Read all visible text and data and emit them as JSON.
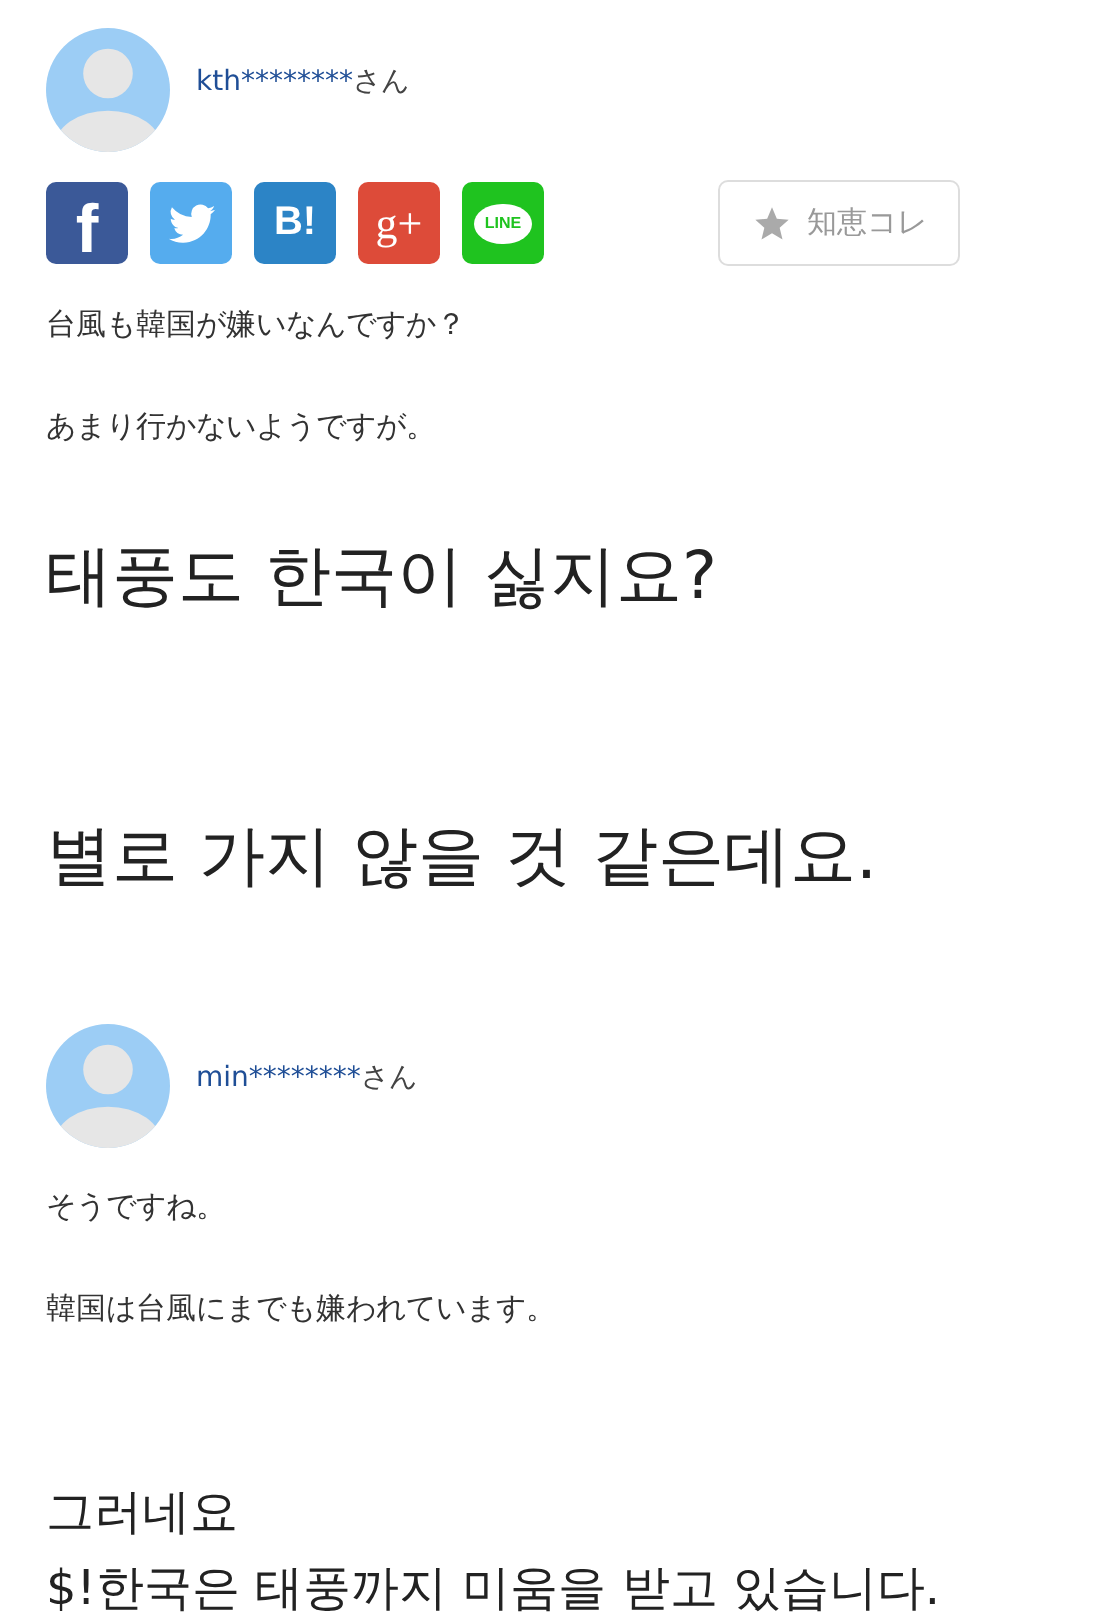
{
  "question": {
    "user": {
      "name": "kth********",
      "suffix": "さん"
    },
    "share_buttons": [
      {
        "kind": "facebook",
        "label": "f"
      },
      {
        "kind": "twitter"
      },
      {
        "kind": "hatena",
        "label": "B!"
      },
      {
        "kind": "google",
        "label": "g+"
      },
      {
        "kind": "line",
        "label": "LINE"
      }
    ],
    "collect_button": {
      "label": "知恵コレ"
    },
    "body": [
      "台風も韓国が嫌いなんですか？",
      "あまり行かないようですが。"
    ]
  },
  "translation_1": [
    "태풍도 한국이 싫지요?",
    "별로 가지 않을 것 같은데요."
  ],
  "answer": {
    "user": {
      "name": "min********",
      "suffix": "さん"
    },
    "body": [
      "そうですね。",
      "韓国は台風にまでも嫌われています。"
    ]
  },
  "translation_2": [
    "그러네요",
    "$!한국은 태풍까지 미움을 받고 있습니다."
  ]
}
